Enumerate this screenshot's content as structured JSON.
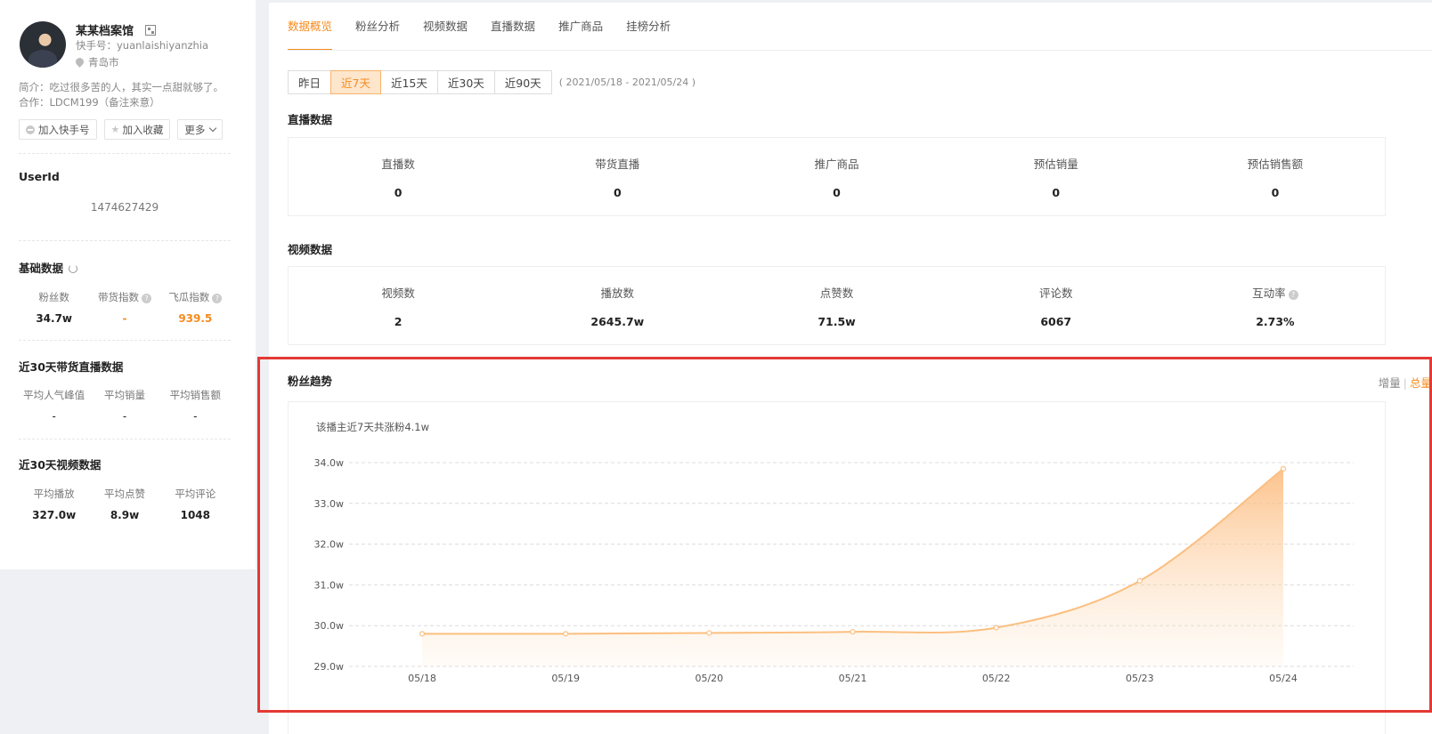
{
  "profile": {
    "name": "某某档案馆",
    "kuaishou_id": "快手号：yuanlaishiyanzhia",
    "location": "青岛市",
    "intro": "简介：吃过很多苦的人，其实一点甜就够了。",
    "coop": "合作：LDCM199（备注来意）",
    "buttons": {
      "add_account": "加入快手号",
      "favorite": "加入收藏",
      "more": "更多"
    }
  },
  "userid": {
    "title": "UserId",
    "value": "1474627429"
  },
  "basic": {
    "title": "基础数据",
    "items": [
      {
        "label": "粉丝数",
        "value": "34.7w"
      },
      {
        "label": "带货指数",
        "value": "-"
      },
      {
        "label": "飞瓜指数",
        "value": "939.5"
      }
    ]
  },
  "live30": {
    "title": "近30天带货直播数据",
    "items": [
      {
        "label": "平均人气峰值",
        "value": "-"
      },
      {
        "label": "平均销量",
        "value": "-"
      },
      {
        "label": "平均销售额",
        "value": "-"
      }
    ]
  },
  "video30": {
    "title": "近30天视频数据",
    "items": [
      {
        "label": "平均播放",
        "value": "327.0w"
      },
      {
        "label": "平均点赞",
        "value": "8.9w"
      },
      {
        "label": "平均评论",
        "value": "1048"
      }
    ]
  },
  "tabs": [
    "数据概览",
    "粉丝分析",
    "视频数据",
    "直播数据",
    "推广商品",
    "挂榜分析"
  ],
  "ranges": [
    "昨日",
    "近7天",
    "近15天",
    "近30天",
    "近90天"
  ],
  "date_range": "( 2021/05/18 - 2021/05/24 )",
  "live_section": {
    "title": "直播数据",
    "items": [
      {
        "label": "直播数",
        "value": "0"
      },
      {
        "label": "带货直播",
        "value": "0"
      },
      {
        "label": "推广商品",
        "value": "0"
      },
      {
        "label": "预估销量",
        "value": "0"
      },
      {
        "label": "预估销售额",
        "value": "0"
      }
    ]
  },
  "video_section": {
    "title": "视频数据",
    "items": [
      {
        "label": "视频数",
        "value": "2"
      },
      {
        "label": "播放数",
        "value": "2645.7w"
      },
      {
        "label": "点赞数",
        "value": "71.5w"
      },
      {
        "label": "评论数",
        "value": "6067"
      },
      {
        "label": "互动率",
        "value": "2.73%"
      }
    ]
  },
  "fans_trend": {
    "title": "粉丝趋势",
    "toggle": {
      "increment": "增量",
      "separator": "|",
      "total": "总量"
    },
    "note": "该播主近7天共涨粉4.1w"
  },
  "colors": {
    "accent": "#f68b1f",
    "line": "#fbbf80",
    "highlight": "#e53935"
  },
  "chart_data": {
    "type": "area",
    "categories": [
      "05/18",
      "05/19",
      "05/20",
      "05/21",
      "05/22",
      "05/23",
      "05/24"
    ],
    "series": [
      {
        "values": [
          29.8,
          29.8,
          29.82,
          29.85,
          29.95,
          31.1,
          33.85
        ]
      }
    ],
    "ylim": [
      29.0,
      34.0
    ],
    "yticks": [
      "29.0w",
      "30.0w",
      "31.0w",
      "32.0w",
      "33.0w",
      "34.0w"
    ],
    "ytick_values": [
      29,
      30,
      31,
      32,
      33,
      34
    ],
    "grid": true
  }
}
